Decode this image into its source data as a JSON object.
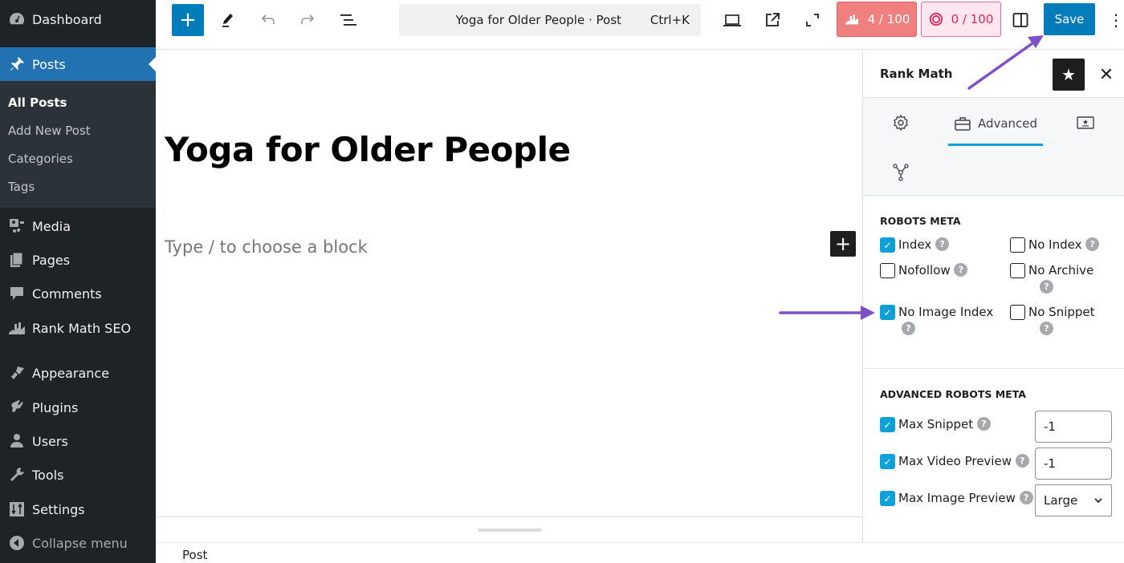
{
  "sidebar": {
    "items": [
      {
        "label": "Dashboard",
        "icon": "dashboard-icon"
      },
      {
        "label": "Posts",
        "icon": "pin-icon"
      },
      {
        "label": "Media",
        "icon": "media-icon"
      },
      {
        "label": "Pages",
        "icon": "pages-icon"
      },
      {
        "label": "Comments",
        "icon": "comment-icon"
      },
      {
        "label": "Rank Math SEO",
        "icon": "rank-math-icon"
      },
      {
        "label": "Appearance",
        "icon": "paintbrush-icon"
      },
      {
        "label": "Plugins",
        "icon": "plugin-icon"
      },
      {
        "label": "Users",
        "icon": "user-icon"
      },
      {
        "label": "Tools",
        "icon": "wrench-icon"
      },
      {
        "label": "Settings",
        "icon": "sliders-icon"
      },
      {
        "label": "Collapse menu",
        "icon": "collapse-icon"
      }
    ],
    "submenu": [
      "All Posts",
      "Add New Post",
      "Categories",
      "Tags"
    ]
  },
  "toolbar": {
    "command_title": "Yoga for Older People · Post",
    "command_shortcut": "Ctrl+K",
    "seo_score": "4 / 100",
    "ai_score": "0 / 100",
    "save_label": "Save"
  },
  "editor": {
    "title": "Yoga for Older People",
    "placeholder": "Type / to choose a block"
  },
  "footer": {
    "breadcrumb": "Post"
  },
  "panel": {
    "title": "Rank Math",
    "tabs": {
      "active_label": "Advanced"
    },
    "robots_meta": {
      "title": "ROBOTS META",
      "options": [
        {
          "label": "Index",
          "checked": true
        },
        {
          "label": "No Index",
          "checked": false
        },
        {
          "label": "Nofollow",
          "checked": false
        },
        {
          "label": "No Archive",
          "checked": false
        },
        {
          "label": "No Image Index",
          "checked": true
        },
        {
          "label": "No Snippet",
          "checked": false
        }
      ]
    },
    "advanced_robots_meta": {
      "title": "ADVANCED ROBOTS META",
      "max_snippet_label": "Max Snippet",
      "max_snippet_value": "-1",
      "max_video_label": "Max Video Preview",
      "max_video_value": "-1",
      "max_image_label": "Max Image Preview",
      "max_image_value": "Large"
    }
  },
  "colors": {
    "accent": "#007cba",
    "tab_active": "#0ea0d8",
    "annotation": "#7e4fc6",
    "seo_bad": "#f08080"
  }
}
